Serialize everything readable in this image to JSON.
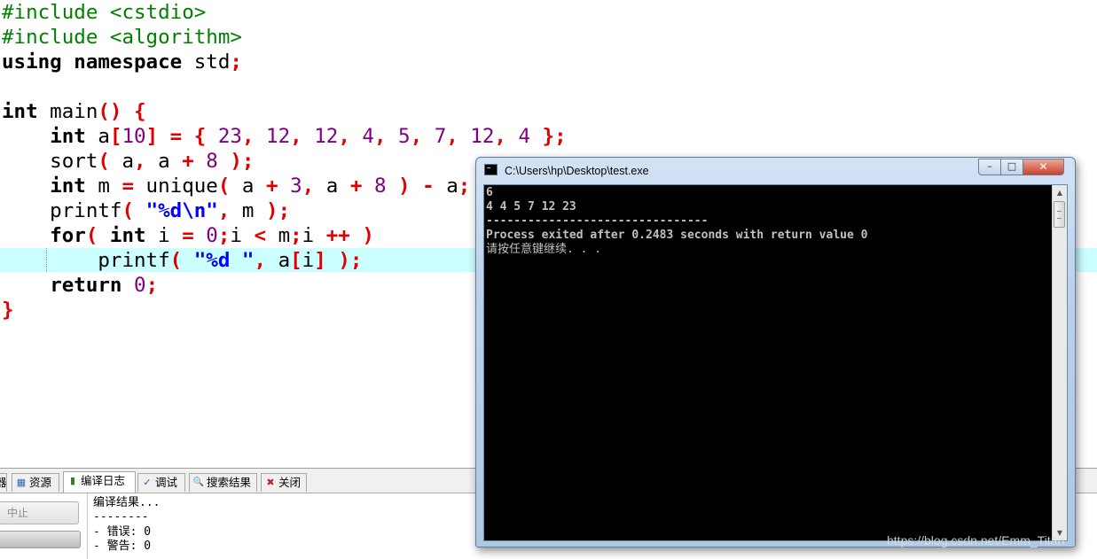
{
  "editor": {
    "highlight_color": "#ccffff",
    "colors": {
      "preprocessor": "#008000",
      "symbol": "#e00000",
      "number": "#800080",
      "string": "#0000ff"
    },
    "lines": [
      [
        {
          "t": "#include <cstdio>",
          "c": "pre"
        }
      ],
      [
        {
          "t": "#include <algorithm>",
          "c": "pre"
        }
      ],
      [
        {
          "t": "using",
          "c": "kw"
        },
        {
          "t": " "
        },
        {
          "t": "namespace",
          "c": "kw"
        },
        {
          "t": " std"
        },
        {
          "t": ";",
          "c": "sym"
        }
      ],
      [],
      [
        {
          "t": "int",
          "c": "kw"
        },
        {
          "t": " main"
        },
        {
          "t": "()",
          "c": "sym"
        },
        {
          "t": " "
        },
        {
          "t": "{",
          "c": "sym"
        }
      ],
      [
        {
          "t": "    "
        },
        {
          "t": "int",
          "c": "kw"
        },
        {
          "t": " a"
        },
        {
          "t": "[",
          "c": "sym"
        },
        {
          "t": "10",
          "c": "num"
        },
        {
          "t": "]",
          "c": "sym"
        },
        {
          "t": " "
        },
        {
          "t": "=",
          "c": "sym"
        },
        {
          "t": " "
        },
        {
          "t": "{",
          "c": "sym"
        },
        {
          "t": " "
        },
        {
          "t": "23",
          "c": "num"
        },
        {
          "t": ",",
          "c": "sym"
        },
        {
          "t": " "
        },
        {
          "t": "12",
          "c": "num"
        },
        {
          "t": ",",
          "c": "sym"
        },
        {
          "t": " "
        },
        {
          "t": "12",
          "c": "num"
        },
        {
          "t": ",",
          "c": "sym"
        },
        {
          "t": " "
        },
        {
          "t": "4",
          "c": "num"
        },
        {
          "t": ",",
          "c": "sym"
        },
        {
          "t": " "
        },
        {
          "t": "5",
          "c": "num"
        },
        {
          "t": ",",
          "c": "sym"
        },
        {
          "t": " "
        },
        {
          "t": "7",
          "c": "num"
        },
        {
          "t": ",",
          "c": "sym"
        },
        {
          "t": " "
        },
        {
          "t": "12",
          "c": "num"
        },
        {
          "t": ",",
          "c": "sym"
        },
        {
          "t": " "
        },
        {
          "t": "4",
          "c": "num"
        },
        {
          "t": " "
        },
        {
          "t": "};",
          "c": "sym"
        }
      ],
      [
        {
          "t": "    sort"
        },
        {
          "t": "(",
          "c": "sym"
        },
        {
          "t": " a"
        },
        {
          "t": ",",
          "c": "sym"
        },
        {
          "t": " a "
        },
        {
          "t": "+",
          "c": "sym"
        },
        {
          "t": " "
        },
        {
          "t": "8",
          "c": "num"
        },
        {
          "t": " "
        },
        {
          "t": ");",
          "c": "sym"
        }
      ],
      [
        {
          "t": "    "
        },
        {
          "t": "int",
          "c": "kw"
        },
        {
          "t": " m "
        },
        {
          "t": "=",
          "c": "sym"
        },
        {
          "t": " unique"
        },
        {
          "t": "(",
          "c": "sym"
        },
        {
          "t": " a "
        },
        {
          "t": "+",
          "c": "sym"
        },
        {
          "t": " "
        },
        {
          "t": "3",
          "c": "num"
        },
        {
          "t": ",",
          "c": "sym"
        },
        {
          "t": " a "
        },
        {
          "t": "+",
          "c": "sym"
        },
        {
          "t": " "
        },
        {
          "t": "8",
          "c": "num"
        },
        {
          "t": " "
        },
        {
          "t": ")",
          "c": "sym"
        },
        {
          "t": " "
        },
        {
          "t": "-",
          "c": "sym"
        },
        {
          "t": " a"
        },
        {
          "t": ";",
          "c": "sym"
        }
      ],
      [
        {
          "t": "    printf"
        },
        {
          "t": "(",
          "c": "sym"
        },
        {
          "t": " "
        },
        {
          "t": "\"%d\\n\"",
          "c": "str"
        },
        {
          "t": ",",
          "c": "sym"
        },
        {
          "t": " m "
        },
        {
          "t": ");",
          "c": "sym"
        }
      ],
      [
        {
          "t": "    "
        },
        {
          "t": "for",
          "c": "kw"
        },
        {
          "t": "(",
          "c": "sym"
        },
        {
          "t": " "
        },
        {
          "t": "int",
          "c": "kw"
        },
        {
          "t": " i "
        },
        {
          "t": "=",
          "c": "sym"
        },
        {
          "t": " "
        },
        {
          "t": "0",
          "c": "num"
        },
        {
          "t": ";",
          "c": "sym"
        },
        {
          "t": "i "
        },
        {
          "t": "<",
          "c": "sym"
        },
        {
          "t": " m"
        },
        {
          "t": ";",
          "c": "sym"
        },
        {
          "t": "i "
        },
        {
          "t": "++",
          "c": "sym"
        },
        {
          "t": " "
        },
        {
          "t": ")",
          "c": "sym"
        }
      ],
      [
        {
          "t": "        printf"
        },
        {
          "t": "(",
          "c": "sym"
        },
        {
          "t": " "
        },
        {
          "t": "\"%d \"",
          "c": "str"
        },
        {
          "t": ",",
          "c": "sym"
        },
        {
          "t": " a"
        },
        {
          "t": "[",
          "c": "sym"
        },
        {
          "t": "i"
        },
        {
          "t": "]",
          "c": "sym"
        },
        {
          "t": " "
        },
        {
          "t": ");",
          "c": "sym"
        }
      ],
      [
        {
          "t": "    "
        },
        {
          "t": "return",
          "c": "kw"
        },
        {
          "t": " "
        },
        {
          "t": "0",
          "c": "num"
        },
        {
          "t": ";",
          "c": "sym"
        }
      ],
      [
        {
          "t": "}",
          "c": "sym"
        }
      ]
    ]
  },
  "bottom_panel": {
    "tabs": [
      {
        "label": "器",
        "icon": "partial-tab-icon"
      },
      {
        "label": "资源",
        "icon": "resources-icon",
        "glyph": "▦"
      },
      {
        "label": "编译日志",
        "icon": "compile-log-icon",
        "glyph": "▮",
        "active": true
      },
      {
        "label": "调试",
        "icon": "debug-icon",
        "glyph": "✓"
      },
      {
        "label": "搜索结果",
        "icon": "search-results-icon",
        "glyph": "🔍"
      },
      {
        "label": "关闭",
        "icon": "close-panel-icon",
        "glyph": "✖"
      }
    ],
    "abort_label": "中止",
    "log_lines": [
      "编译结果...",
      "--------",
      "- 错误: 0",
      "- 警告: 0"
    ]
  },
  "console": {
    "title": "C:\\Users\\hp\\Desktop\\test.exe",
    "buttons": {
      "minimize": "–",
      "maximize": "□",
      "close": "✕"
    },
    "text_color": "#c0c0c0",
    "lines": [
      "6",
      "4 4 5 7 12 23",
      "--------------------------------",
      "Process exited after 0.2483 seconds with return value 0",
      "请按任意键继续. . ."
    ]
  },
  "watermark": "https://blog.csdn.net/Emm_Titan"
}
